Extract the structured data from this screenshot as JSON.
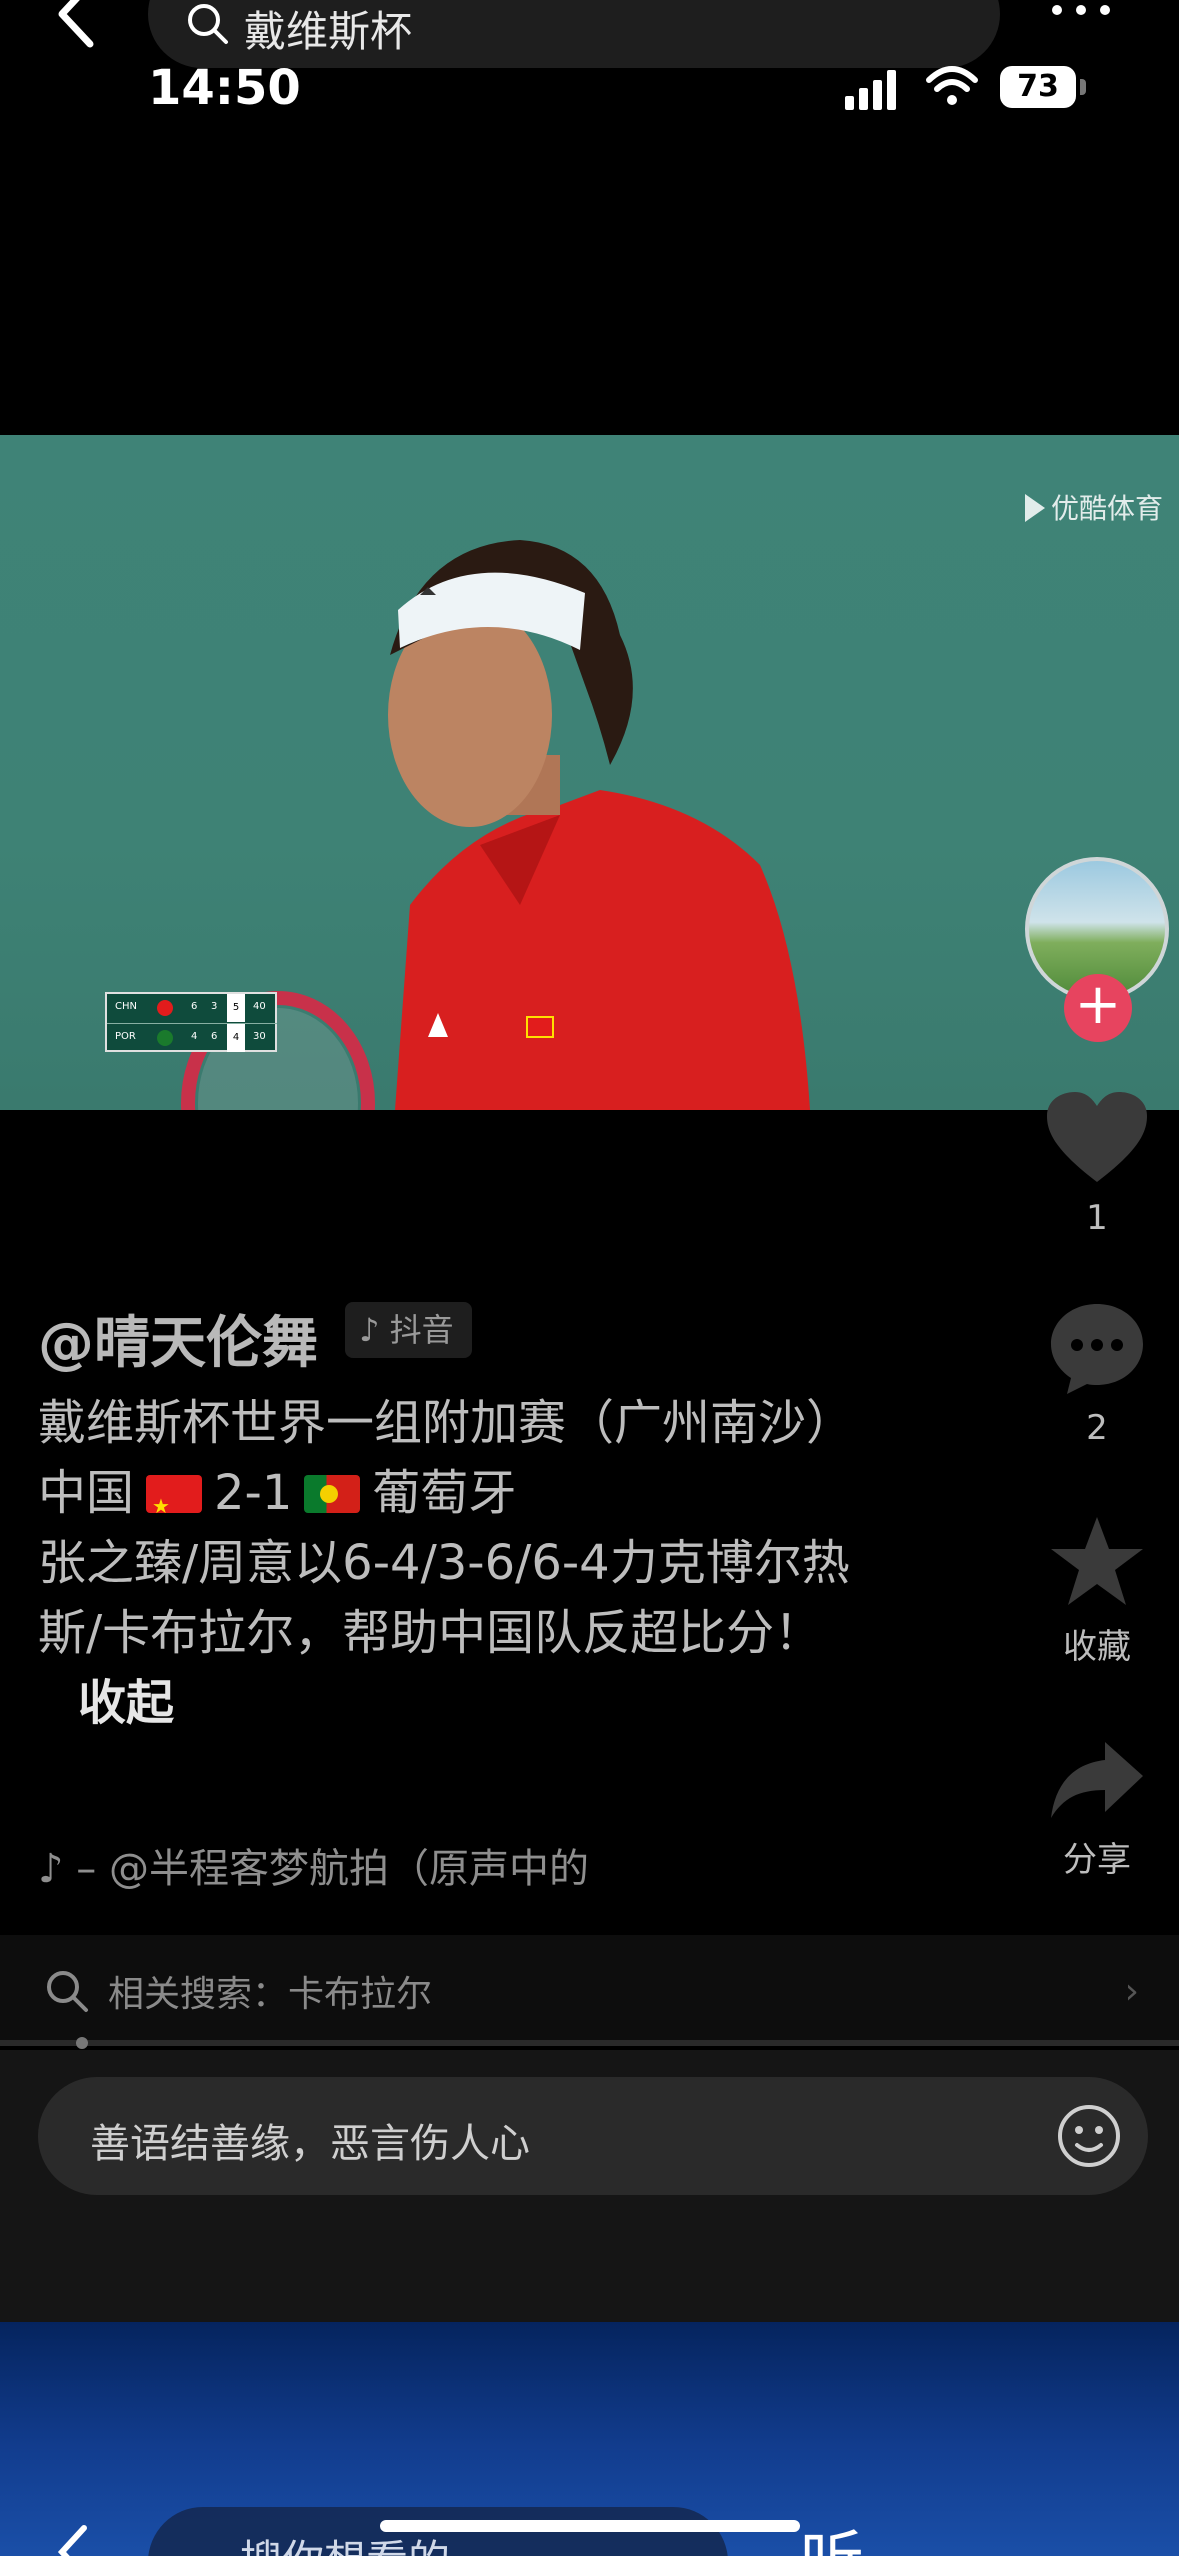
{
  "top_search": {
    "query": "戴维斯杯"
  },
  "status_bar": {
    "time": "14:50",
    "battery": "73"
  },
  "video": {
    "watermark": "优酷体育",
    "scoreboard": {
      "rows": [
        {
          "team": "CHN",
          "set1": "6",
          "set2": "3",
          "set3": "5",
          "points": "40",
          "flag_color": "#e21c1c"
        },
        {
          "team": "POR",
          "set1": "4",
          "set2": "6",
          "set3": "4",
          "points": "30",
          "flag_color": "#1a7a2c"
        }
      ]
    }
  },
  "actions": {
    "like_count": "1",
    "comment_count": "2",
    "favorite_label": "收藏",
    "share_label": "分享"
  },
  "post": {
    "author": "@晴天伦舞",
    "platform": "抖音",
    "caption_line1": "戴维斯杯世界一组附加赛（广州南沙）",
    "score_home": "中国",
    "score": "2-1",
    "score_away": "葡萄牙",
    "caption_line3": "张之臻/周意以6-4/3-6/6-4力克博尔热斯/卡布拉尔，帮助中国队反超比分！",
    "fold_label": "收起",
    "music": "– @半程客梦航拍（原声中的"
  },
  "related": {
    "label": "相关搜索：卡布拉尔"
  },
  "comment_input": {
    "placeholder": "善语结善缘，恶言伤人心"
  },
  "bottom": {
    "search_text": "搜你想看的",
    "listen_label": "听"
  },
  "colors": {
    "accent_follow": "#e7445f",
    "video_bg": "#3f8377",
    "bottom_blue": "#123d8f"
  }
}
